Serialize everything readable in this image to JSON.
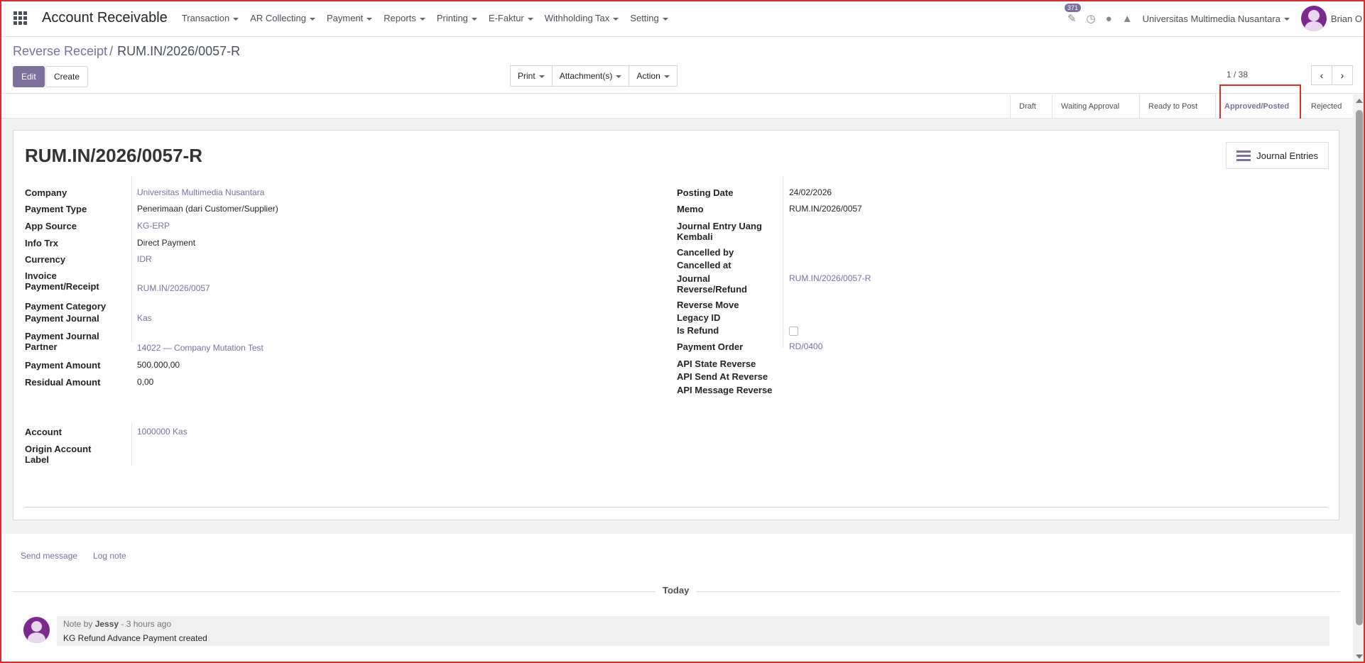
{
  "topbar": {
    "app_title": "Account Receivable",
    "menu": [
      "Transaction",
      "AR Collecting",
      "Payment",
      "Reports",
      "Printing",
      "E-Faktur",
      "Withholding Tax",
      "Setting"
    ],
    "notification_count": "371",
    "company": "Universitas Multimedia Nusantara",
    "user": "Brian O"
  },
  "breadcrumb": {
    "parent": "Reverse Receipt",
    "separator": "/",
    "current": "RUM.IN/2026/0057-R"
  },
  "buttons": {
    "edit": "Edit",
    "create": "Create",
    "print": "Print",
    "attachments": "Attachment(s)",
    "action": "Action"
  },
  "pager": {
    "value": "1 / 38"
  },
  "status_stages": [
    "Draft",
    "Waiting Approval",
    "Ready to Post",
    "Approved/Posted",
    "Rejected"
  ],
  "active_stage": "Approved/Posted",
  "record": {
    "title": "RUM.IN/2026/0057-R",
    "journal_entries_button": "Journal Entries",
    "left_fields": [
      {
        "label": "Company",
        "value": "Universitas Multimedia Nusantara",
        "link": true
      },
      {
        "label": "Payment Type",
        "value": "Penerimaan (dari Customer/Supplier)",
        "link": false
      },
      {
        "label": "App Source",
        "value": "KG-ERP",
        "link": true
      },
      {
        "label": "Info Trx",
        "value": "Direct Payment",
        "link": false
      },
      {
        "label": "Currency",
        "value": "IDR",
        "link": true
      },
      {
        "label": "Invoice Payment/Receipt",
        "value": "RUM.IN/2026/0057",
        "link": true
      },
      {
        "label": "Payment Category",
        "value": "",
        "link": false
      },
      {
        "label": "Payment Journal",
        "value": "Kas",
        "link": true
      },
      {
        "label": "Payment Journal Partner",
        "value": "14022 — Company Mutation Test",
        "link": true
      },
      {
        "label": "Payment Amount",
        "value": "500.000,00",
        "link": false
      },
      {
        "label": "Residual Amount",
        "value": "0,00",
        "link": false
      }
    ],
    "right_fields": [
      {
        "label": "Posting Date",
        "value": "24/02/2026",
        "link": false
      },
      {
        "label": "Memo",
        "value": "RUM.IN/2026/0057",
        "link": false
      },
      {
        "label": "Journal Entry Uang Kembali",
        "value": "",
        "link": false
      },
      {
        "label": "Cancelled by",
        "value": "",
        "link": false
      },
      {
        "label": "Cancelled at",
        "value": "",
        "link": false
      },
      {
        "label": "Journal Reverse/Refund",
        "value": "RUM.IN/2026/0057-R",
        "link": true
      },
      {
        "label": "Reverse Move",
        "value": "",
        "link": false
      },
      {
        "label": "Legacy ID",
        "value": "",
        "link": false
      },
      {
        "label": "Is Refund",
        "value": "",
        "link": false
      },
      {
        "label": "Payment Order",
        "value": "RD/0400",
        "link": true
      },
      {
        "label": "API State Reverse",
        "value": "",
        "link": false
      },
      {
        "label": "API Send At Reverse",
        "value": "",
        "link": false
      },
      {
        "label": "API Message Reverse",
        "value": "",
        "link": false
      }
    ],
    "account_fields": [
      {
        "label": "Account",
        "value": "1000000 Kas",
        "link": true
      },
      {
        "label": "Origin Account Label",
        "value": "",
        "link": false
      }
    ]
  },
  "chatter": {
    "send_message": "Send message",
    "log_note": "Log note",
    "date_separator": "Today",
    "message": {
      "prefix": "Note by",
      "author": "Jessy",
      "time": "- 3 hours ago",
      "body": "KG Refund Advance Payment created"
    }
  }
}
